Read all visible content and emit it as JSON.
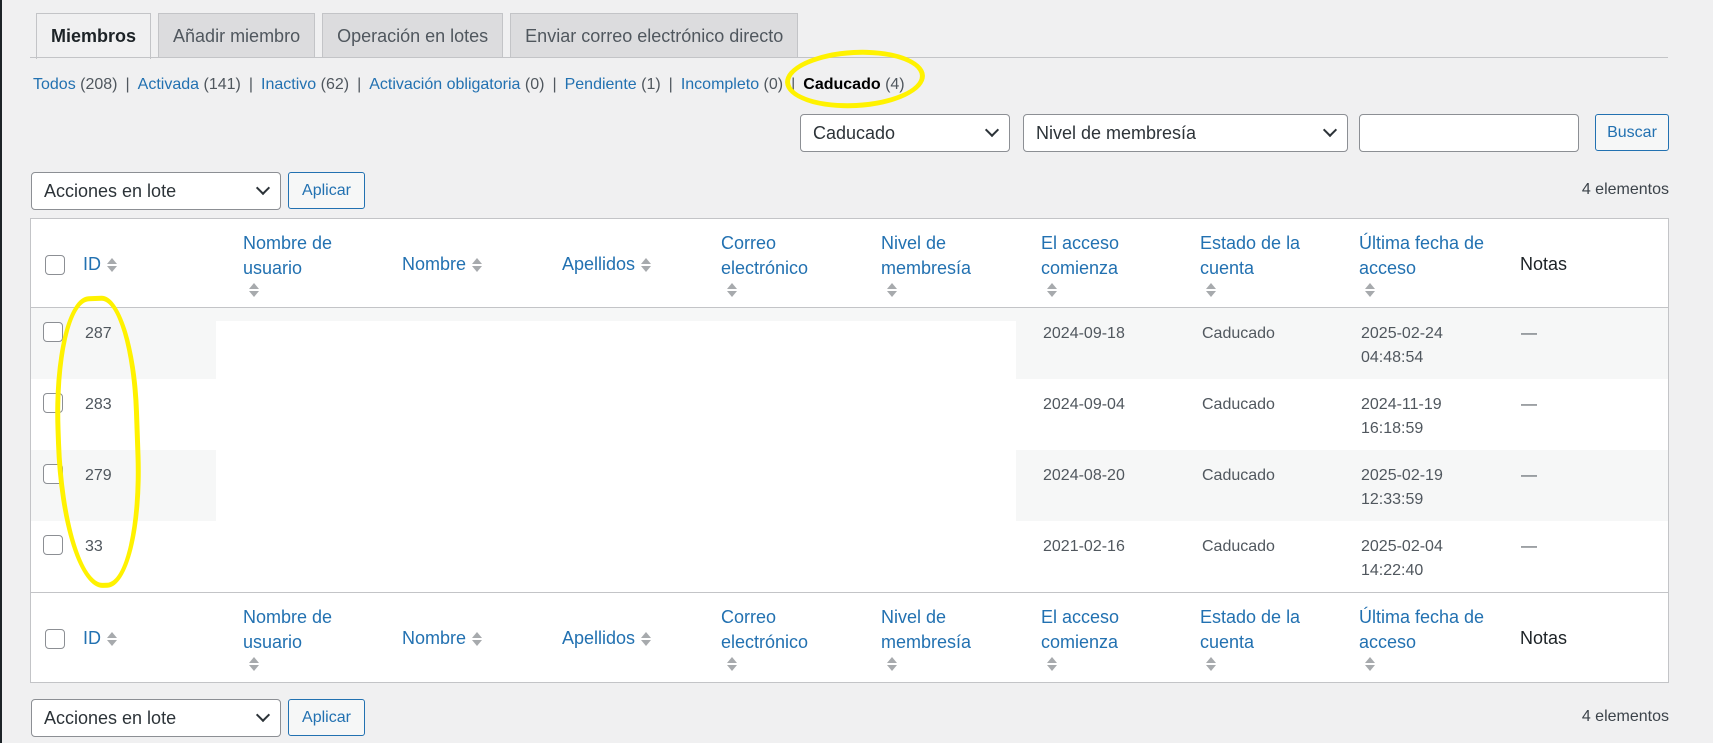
{
  "tabs": [
    "Miembros",
    "Añadir miembro",
    "Operación en lotes",
    "Enviar correo electrónico directo"
  ],
  "filters": [
    {
      "label": "Todos",
      "count": "(208)"
    },
    {
      "label": "Activada",
      "count": "(141)"
    },
    {
      "label": "Inactivo",
      "count": "(62)"
    },
    {
      "label": "Activación obligatoria",
      "count": "(0)"
    },
    {
      "label": "Pendiente",
      "count": "(1)"
    },
    {
      "label": "Incompleto",
      "count": "(0)"
    },
    {
      "label": "Caducado",
      "count": "(4)",
      "current": true
    }
  ],
  "search": {
    "status_select": "Caducado",
    "level_select": "Nivel de membresía",
    "button": "Buscar"
  },
  "bulk": {
    "select": "Acciones en lote",
    "apply": "Aplicar",
    "items_count": "4 elementos"
  },
  "columns": {
    "id": "ID",
    "username": "Nombre de usuario",
    "first_name": "Nombre",
    "last_name": "Apellidos",
    "email": "Correo electrónico",
    "level": "Nivel de membresía",
    "access_start": "El acceso comienza",
    "account_status": "Estado de la cuenta",
    "last_access": "Última fecha de acceso",
    "notes": "Notas"
  },
  "rows": [
    {
      "id": "287",
      "access_start": "2024-09-18",
      "status": "Caducado",
      "last_access_date": "2025-02-24",
      "last_access_time": "04:48:54",
      "notes": "—"
    },
    {
      "id": "283",
      "access_start": "2024-09-04",
      "status": "Caducado",
      "last_access_date": "2024-11-19",
      "last_access_time": "16:18:59",
      "notes": "—"
    },
    {
      "id": "279",
      "access_start": "2024-08-20",
      "status": "Caducado",
      "last_access_date": "2025-02-19",
      "last_access_time": "12:33:59",
      "notes": "—"
    },
    {
      "id": "33",
      "access_start": "2021-02-16",
      "status": "Caducado",
      "last_access_date": "2025-02-04",
      "last_access_time": "14:22:40",
      "notes": "—"
    }
  ],
  "colors": {
    "link": "#2271b1",
    "highlight": "#fff200",
    "background": "#f0f0f1"
  }
}
